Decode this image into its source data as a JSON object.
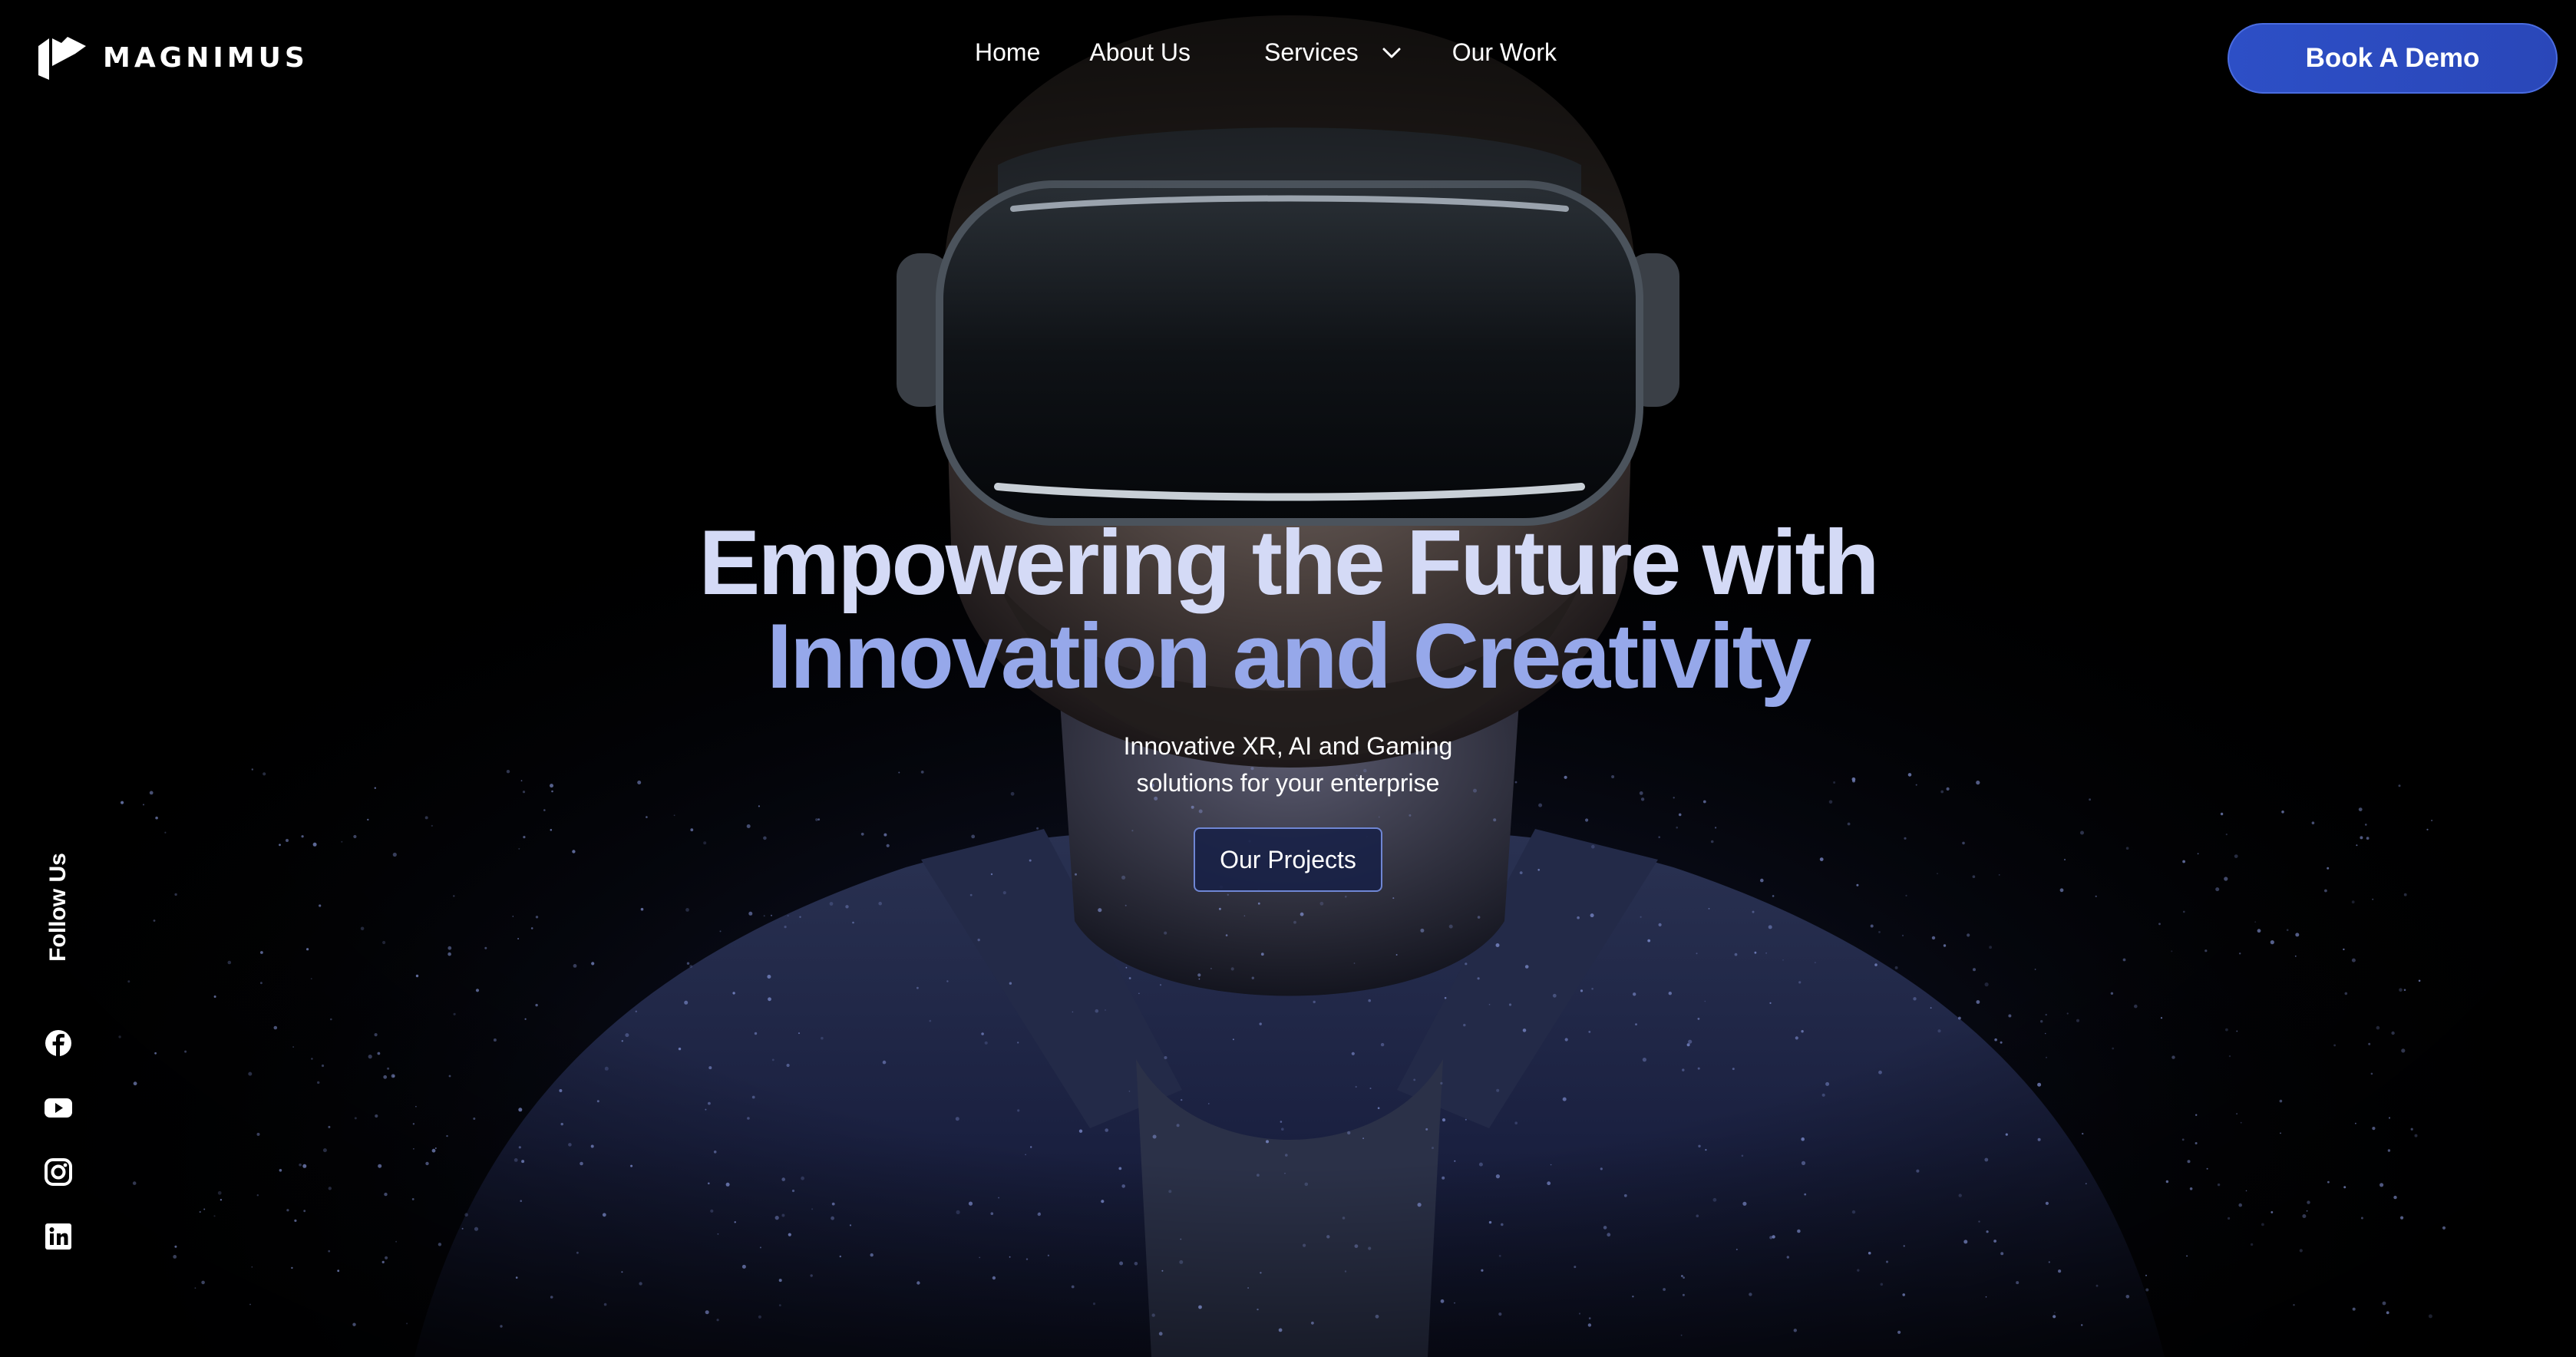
{
  "brand": {
    "name": "MAGNIMUS"
  },
  "nav": {
    "home": "Home",
    "about": "About Us",
    "services": "Services",
    "work": "Our Work"
  },
  "cta": {
    "book_demo": "Book A Demo"
  },
  "hero": {
    "headline_line1": "Empowering the Future with",
    "headline_line2": "Innovation and Creativity",
    "subtitle_line1": "Innovative XR, AI and Gaming",
    "subtitle_line2": "solutions for your enterprise",
    "projects_button": "Our Projects"
  },
  "social": {
    "follow_label": "Follow Us",
    "icons": [
      "facebook-icon",
      "youtube-icon",
      "instagram-icon",
      "linkedin-icon"
    ]
  },
  "colors": {
    "background": "#000000",
    "accent_blue": "#2d4fc6",
    "headline_light": "#d4daf6",
    "headline_blue": "#96a8ea"
  }
}
